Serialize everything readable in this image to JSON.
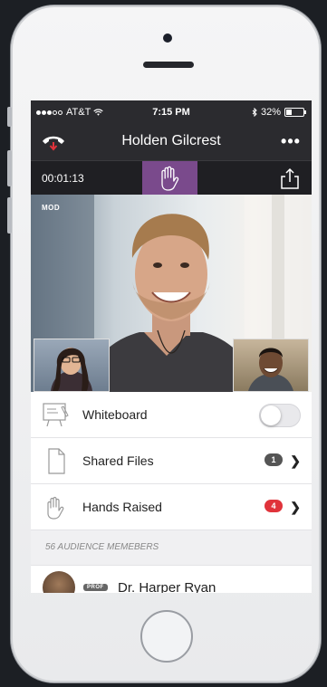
{
  "status_bar": {
    "carrier": "AT&T",
    "time": "7:15 PM",
    "battery": "32%",
    "battery_level": 0.32
  },
  "call": {
    "participant_name": "Holden Gilcrest",
    "more_label": "•••",
    "elapsed": "00:01:13",
    "role_badge": "MOD"
  },
  "menu": {
    "whiteboard_label": "Whiteboard",
    "whiteboard_on": false,
    "shared_files_label": "Shared Files",
    "shared_files_count": "1",
    "hands_raised_label": "Hands Raised",
    "hands_raised_count": "4"
  },
  "audience": {
    "header": "56 AUDIENCE MEMEBERS",
    "members": [
      {
        "badge": "PROF",
        "name": "Dr. Harper Ryan"
      }
    ]
  },
  "colors": {
    "accent_purple": "#7a4a8c",
    "hangup_red": "#e0333b",
    "badge_gray": "#555555",
    "badge_red": "#e0333b",
    "bar_dark": "#2b2b2f"
  },
  "icons": {
    "hangup": "hangup-icon",
    "more": "more-icon",
    "raise_hand": "raise-hand-icon",
    "share": "share-icon",
    "whiteboard": "whiteboard-icon",
    "file": "file-icon",
    "hand": "hand-icon",
    "chevron": "chevron-right-icon"
  }
}
